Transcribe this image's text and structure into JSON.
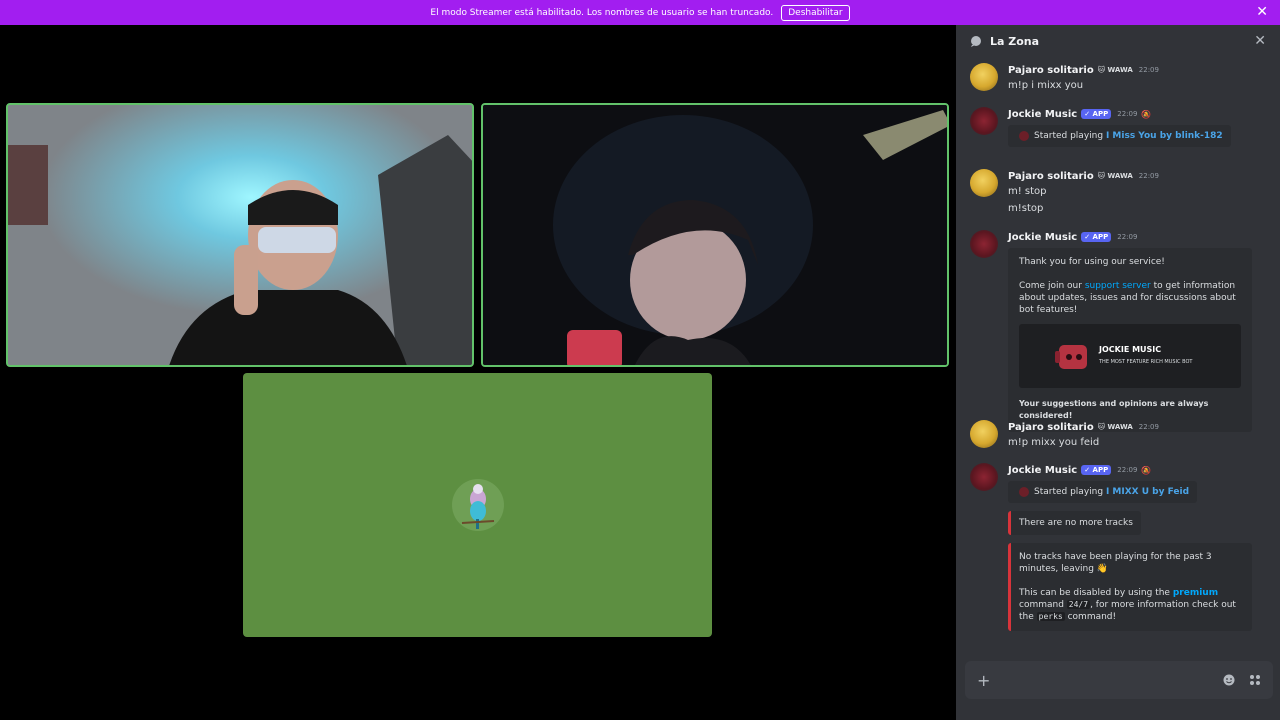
{
  "banner": {
    "message": "El modo Streamer está habilitado. Los nombres de usuario se han truncado.",
    "button_label": "Deshabilitar",
    "close_glyph": "✕"
  },
  "chat": {
    "channel_name": "La Zona",
    "close_glyph": "✕",
    "messages": [
      {
        "author": "Pajaro solitario",
        "tag": "🐱 WAWA",
        "time": "22:09",
        "lines": [
          "m!p i mixx you"
        ]
      },
      {
        "author": "Jockie Music",
        "badge": "✓ APP",
        "time": "22:09",
        "embed_prefix": "Started playing ",
        "embed_link": "I Miss You by blink-182"
      },
      {
        "author": "Pajaro solitario",
        "tag": "🐱 WAWA",
        "time": "22:09",
        "lines": [
          "m! stop",
          "m!stop"
        ]
      },
      {
        "author": "Jockie Music",
        "badge": "✓ APP",
        "time": "22:09",
        "embed_thanks": "Thank you for using our service!",
        "embed_join_a": "Come join our ",
        "embed_join_link": "support server",
        "embed_join_b": " to get information about updates, issues and for discussions about bot features!",
        "promo_title": "JOCKIE MUSIC",
        "promo_sub": "THE MOST FEATURE RICH MUSIC BOT",
        "embed_footer": "Your suggestions and opinions are always considered!"
      },
      {
        "author": "Pajaro solitario",
        "tag": "🐱 WAWA",
        "time": "22:09",
        "lines": [
          "m!p mixx you feid"
        ]
      },
      {
        "author": "Jockie Music",
        "badge": "✓ APP",
        "time": "22:09",
        "embed_prefix": "Started playing ",
        "embed_link": "I MIXX U by Feid",
        "no_more": "There are no more tracks",
        "idle_a": "No tracks have been playing for the past 3 minutes, leaving 👋",
        "idle_b1": "This can be disabled by using the ",
        "idle_b_link": "premium",
        "idle_b2": " command ",
        "idle_code1": "24/7",
        "idle_b3": ", for more information check out the ",
        "idle_code2": "perks",
        "idle_b4": " command!"
      }
    ]
  },
  "composer": {
    "plus_glyph": "+"
  },
  "colors": {
    "banner": "#a21ef0",
    "speaking_border": "#62c26a",
    "app_badge": "#5865f2",
    "link": "#4aa4e8",
    "embed_red": "#d8343b"
  }
}
